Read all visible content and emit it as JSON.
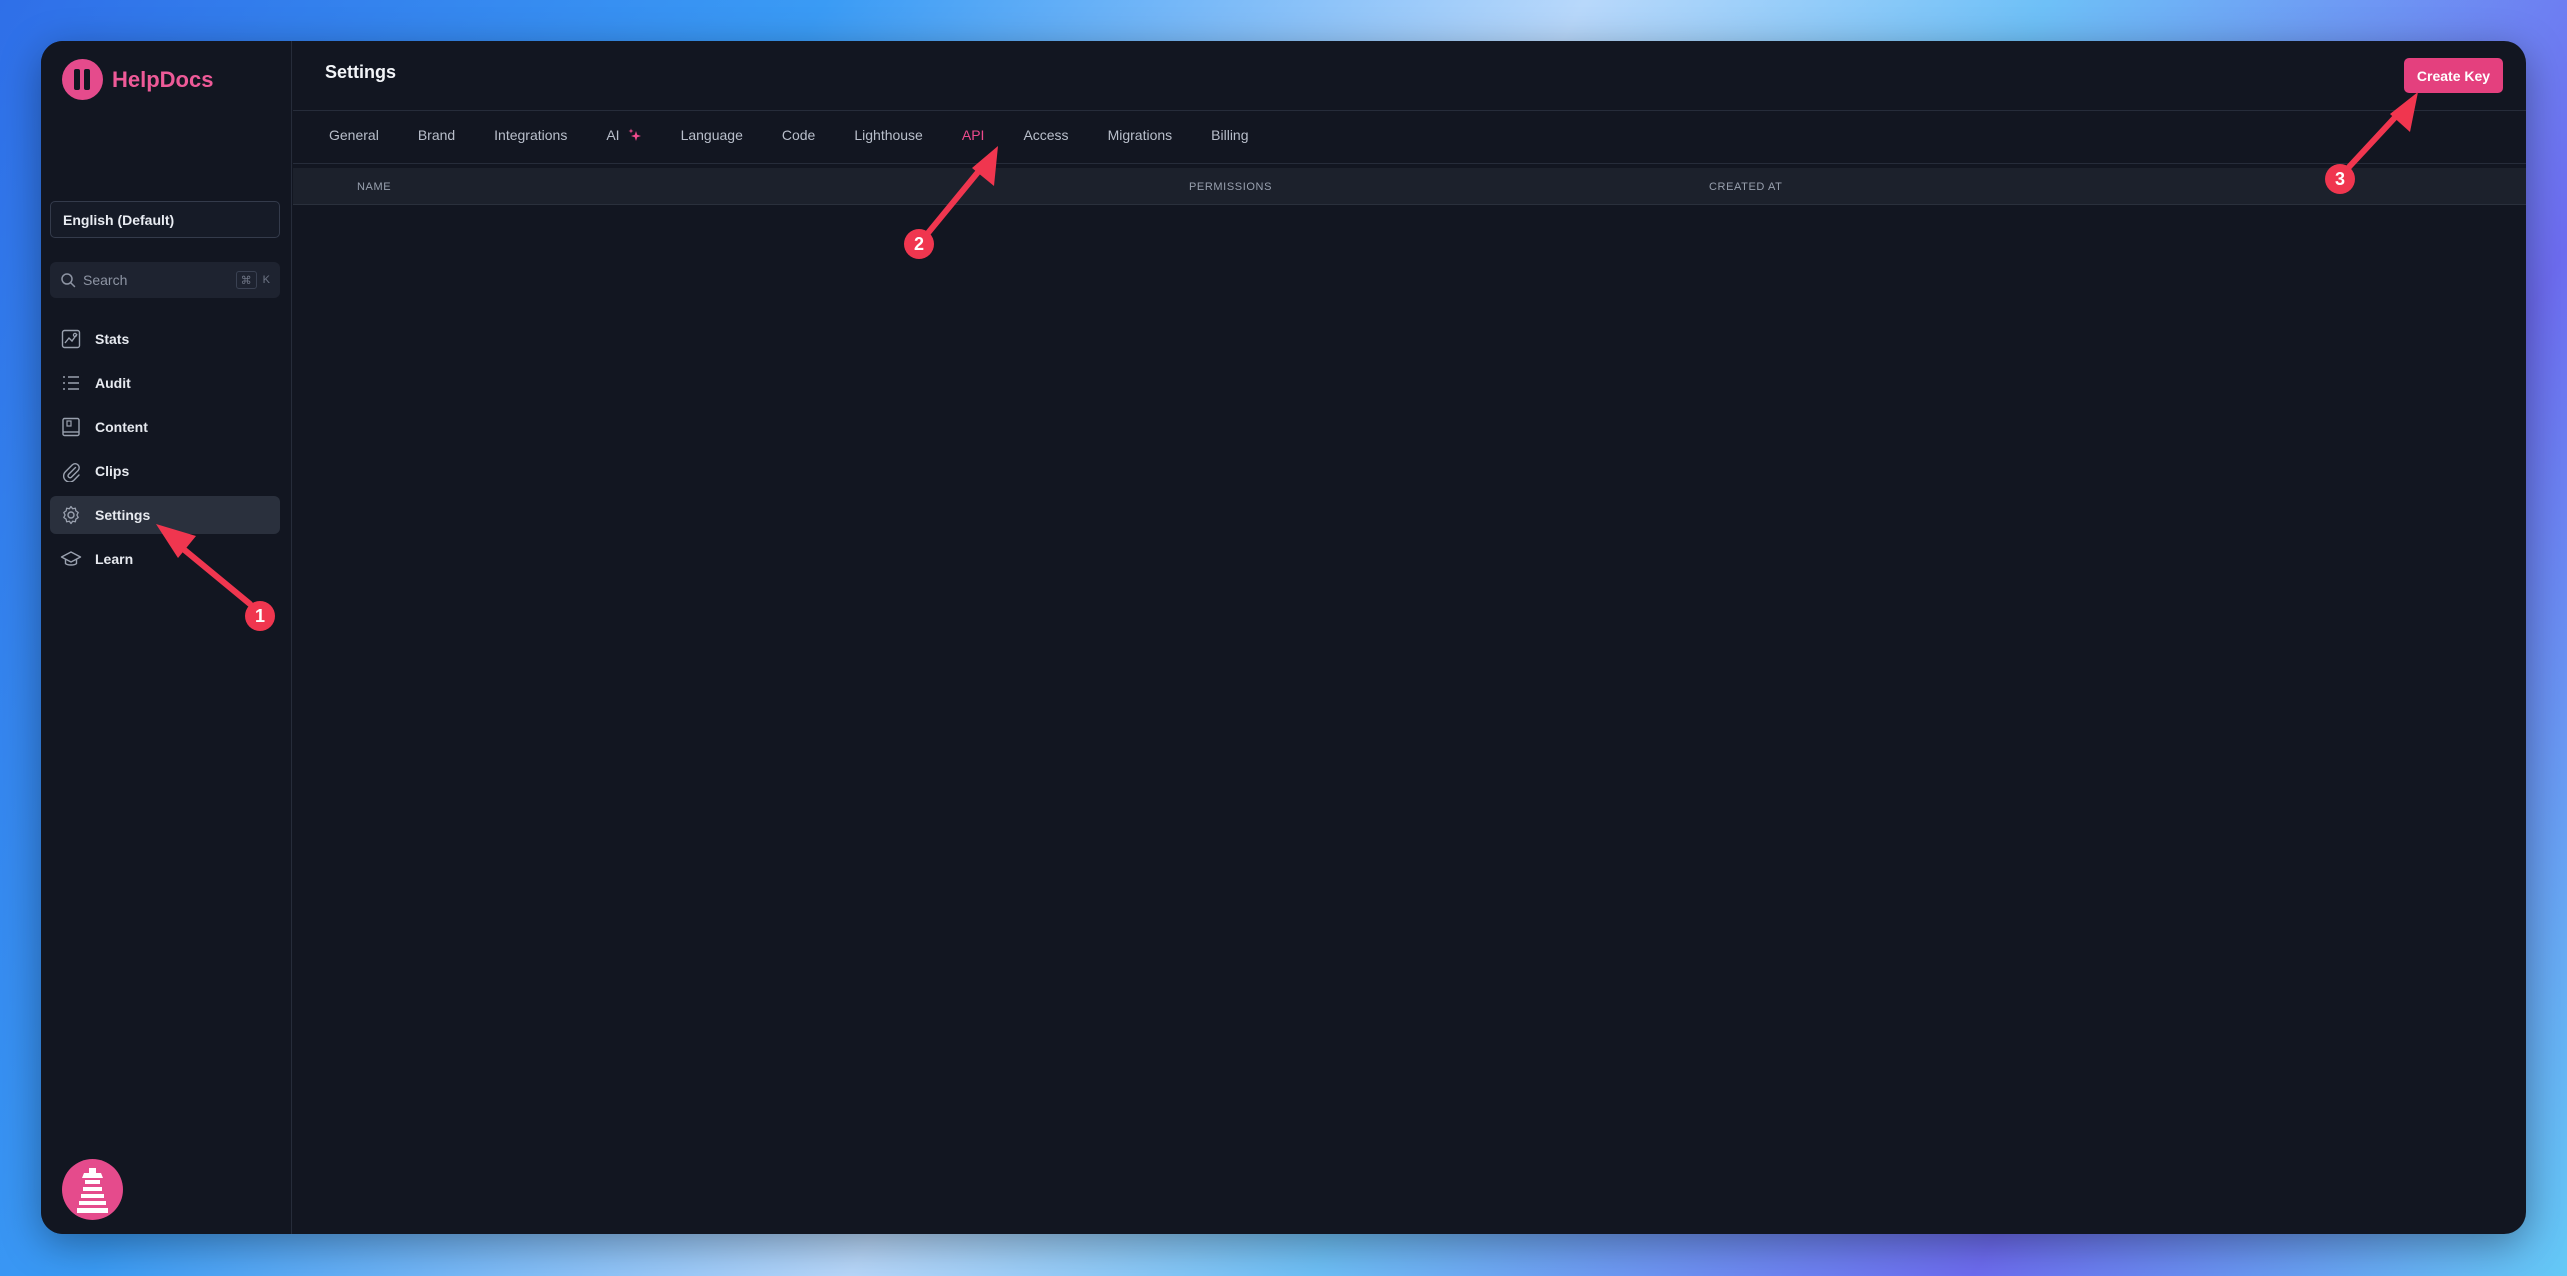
{
  "app": {
    "name": "HelpDocs"
  },
  "sidebar": {
    "language": "English (Default)",
    "search": {
      "placeholder": "Search",
      "shortcut_mod": "⌘",
      "shortcut_key": "K"
    },
    "items": [
      {
        "label": "Stats",
        "icon": "stats-icon"
      },
      {
        "label": "Audit",
        "icon": "list-icon"
      },
      {
        "label": "Content",
        "icon": "book-icon"
      },
      {
        "label": "Clips",
        "icon": "paperclip-icon"
      },
      {
        "label": "Settings",
        "icon": "gear-icon",
        "active": true
      },
      {
        "label": "Learn",
        "icon": "graduation-cap-icon"
      }
    ]
  },
  "header": {
    "title": "Settings",
    "create_label": "Create Key"
  },
  "tabs": [
    {
      "label": "General"
    },
    {
      "label": "Brand"
    },
    {
      "label": "Integrations"
    },
    {
      "label": "AI",
      "icon": "sparkle-icon"
    },
    {
      "label": "Language"
    },
    {
      "label": "Code"
    },
    {
      "label": "Lighthouse"
    },
    {
      "label": "API",
      "active": true
    },
    {
      "label": "Access"
    },
    {
      "label": "Migrations"
    },
    {
      "label": "Billing"
    }
  ],
  "table": {
    "columns": [
      "NAME",
      "PERMISSIONS",
      "CREATED AT"
    ]
  },
  "annotations": [
    "1",
    "2",
    "3"
  ],
  "colors": {
    "accent": "#e4407e",
    "annotation": "#f0364f",
    "background": "#121621"
  }
}
